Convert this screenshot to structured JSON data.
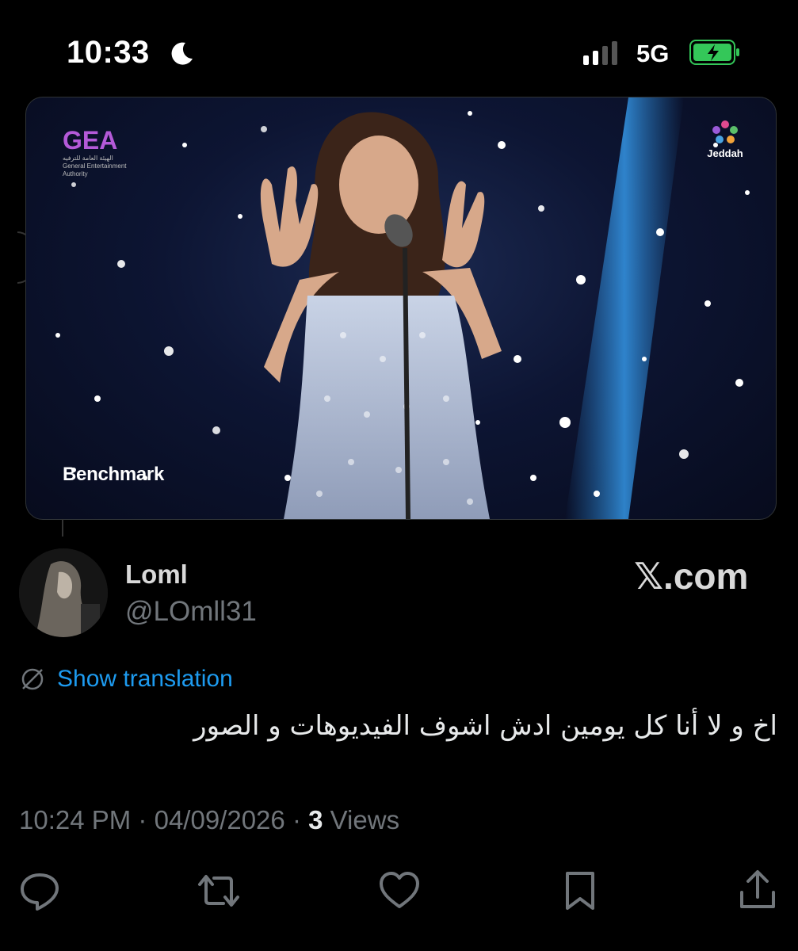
{
  "status_bar": {
    "time": "10:33",
    "network": "5G",
    "icons": [
      "moon-icon",
      "signal-icon",
      "battery-charging-icon"
    ],
    "battery_color": "#34c759"
  },
  "media": {
    "corner_logo_left": "GEA",
    "corner_logo_left_sub": "الهيئة العامة للترفيه General Entertainment Authority",
    "corner_logo_right": "Jeddah",
    "watermark": "Benchmark"
  },
  "author": {
    "display_name": "Loml",
    "handle": "@LOmll31",
    "brand": "𝕏.com"
  },
  "translation": {
    "label": "Show translation",
    "icon": "globe-slash-icon",
    "color": "#1d9bf0"
  },
  "tweet": {
    "text": "اخ و لا أنا كل يومين ادش اشوف الفيديوهات و الصور"
  },
  "meta": {
    "time": "10:24 PM",
    "separator": "·",
    "date": "04/09/2026",
    "views_count": "3",
    "views_label": "Views"
  },
  "actions": [
    {
      "icon": "reply-icon"
    },
    {
      "icon": "retweet-icon"
    },
    {
      "icon": "like-icon"
    },
    {
      "icon": "bookmark-icon"
    },
    {
      "icon": "share-icon"
    }
  ]
}
